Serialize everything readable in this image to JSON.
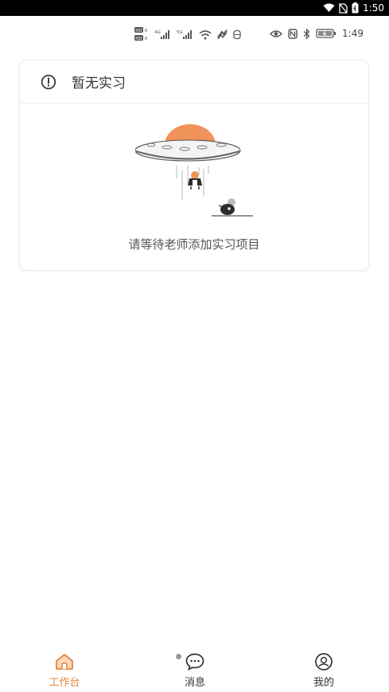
{
  "system_bar": {
    "time": "1:50",
    "icons": [
      "wifi-icon",
      "no-sim-icon",
      "battery-icon"
    ]
  },
  "status_bar": {
    "left_icons": [
      "hd-icon",
      "signal-4g-icon",
      "signal-5g-icon",
      "wifi-icon",
      "nfc-link-icon",
      "data-icon"
    ],
    "right_icons": [
      "eye-icon",
      "nfc-icon",
      "bluetooth-icon",
      "battery-icon"
    ],
    "time": "1:49"
  },
  "card": {
    "icon": "alert-circle-icon",
    "title": "暂无实习",
    "empty_message": "请等待老师添加实习项目",
    "illustration": "ufo-empty-state-illustration"
  },
  "colors": {
    "accent": "#e8853d",
    "ufo_dome": "#f0935a",
    "text_primary": "#333333",
    "text_secondary": "#555555"
  },
  "tabbar": {
    "tabs": [
      {
        "label": "工作台",
        "icon": "home-icon",
        "active": true
      },
      {
        "label": "消息",
        "icon": "chat-icon",
        "active": false,
        "badge": "dot"
      },
      {
        "label": "我的",
        "icon": "user-icon",
        "active": false
      }
    ]
  }
}
